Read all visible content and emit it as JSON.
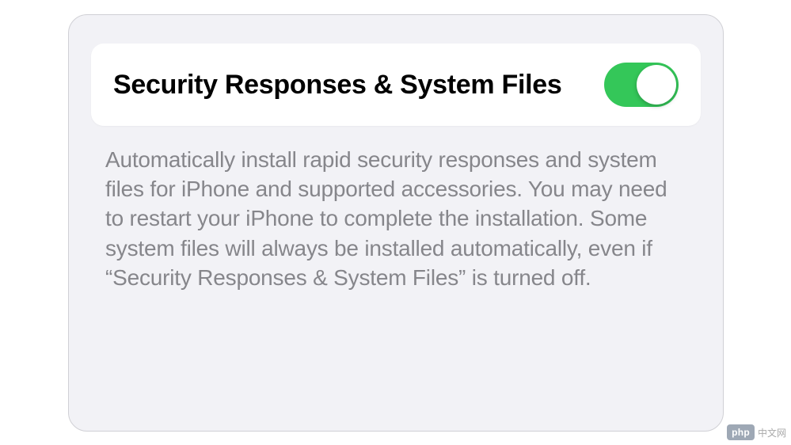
{
  "setting": {
    "title": "Security Responses & System Files",
    "toggle_on": true,
    "description": "Automatically install rapid security responses and system files for iPhone and supported accessories. You may need to restart your iPhone to complete the installation. Some system files will always be installed automatically, even if “Security Responses & System Files” is turned off."
  },
  "watermark": {
    "badge": "php",
    "text": "中文网"
  },
  "colors": {
    "toggle_on": "#34c759",
    "panel_bg": "#f2f2f6",
    "description_text": "#86868b"
  }
}
